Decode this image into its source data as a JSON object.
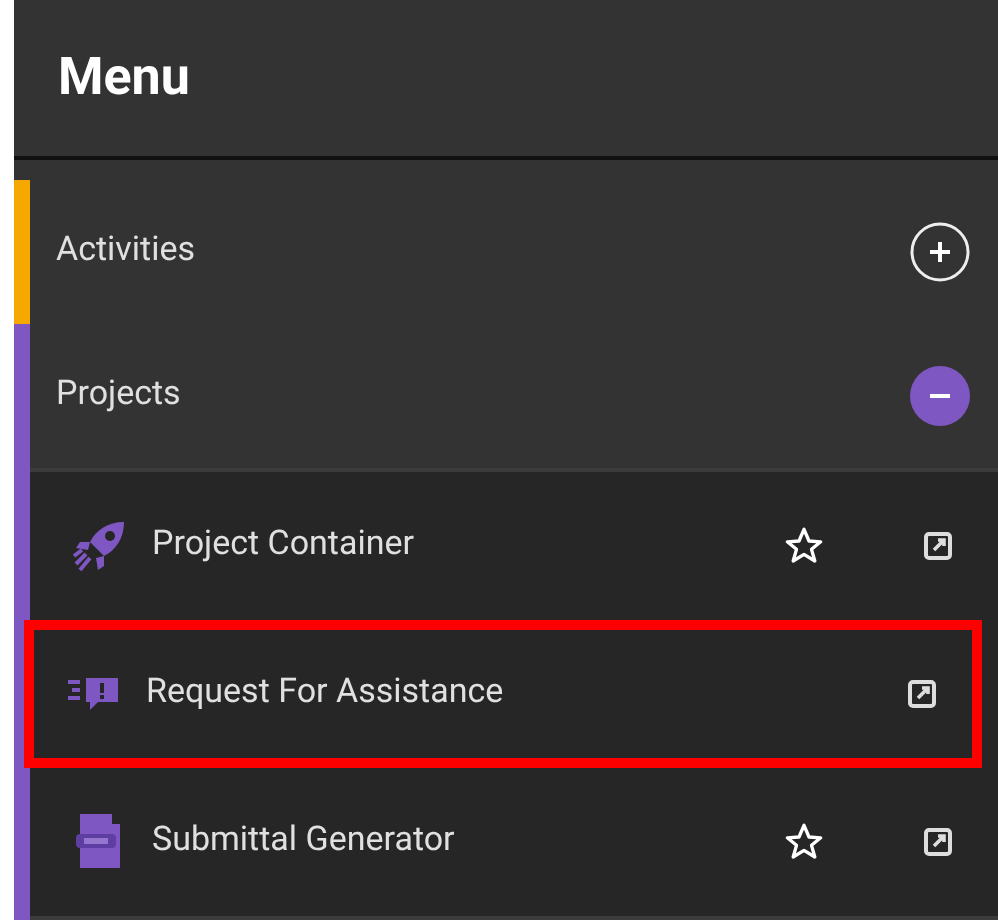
{
  "header": {
    "title": "Menu"
  },
  "sections": [
    {
      "label": "Activities",
      "color": "#f5a800",
      "expanded": false
    },
    {
      "label": "Projects",
      "color": "#7e57c2",
      "expanded": true,
      "items": [
        {
          "label": "Project Container",
          "kind": "rocket",
          "has_star": true,
          "highlighted": false
        },
        {
          "label": "Request For Assistance",
          "kind": "alert",
          "has_star": false,
          "highlighted": true
        },
        {
          "label": "Submittal Generator",
          "kind": "document",
          "has_star": true,
          "highlighted": false
        }
      ]
    }
  ]
}
